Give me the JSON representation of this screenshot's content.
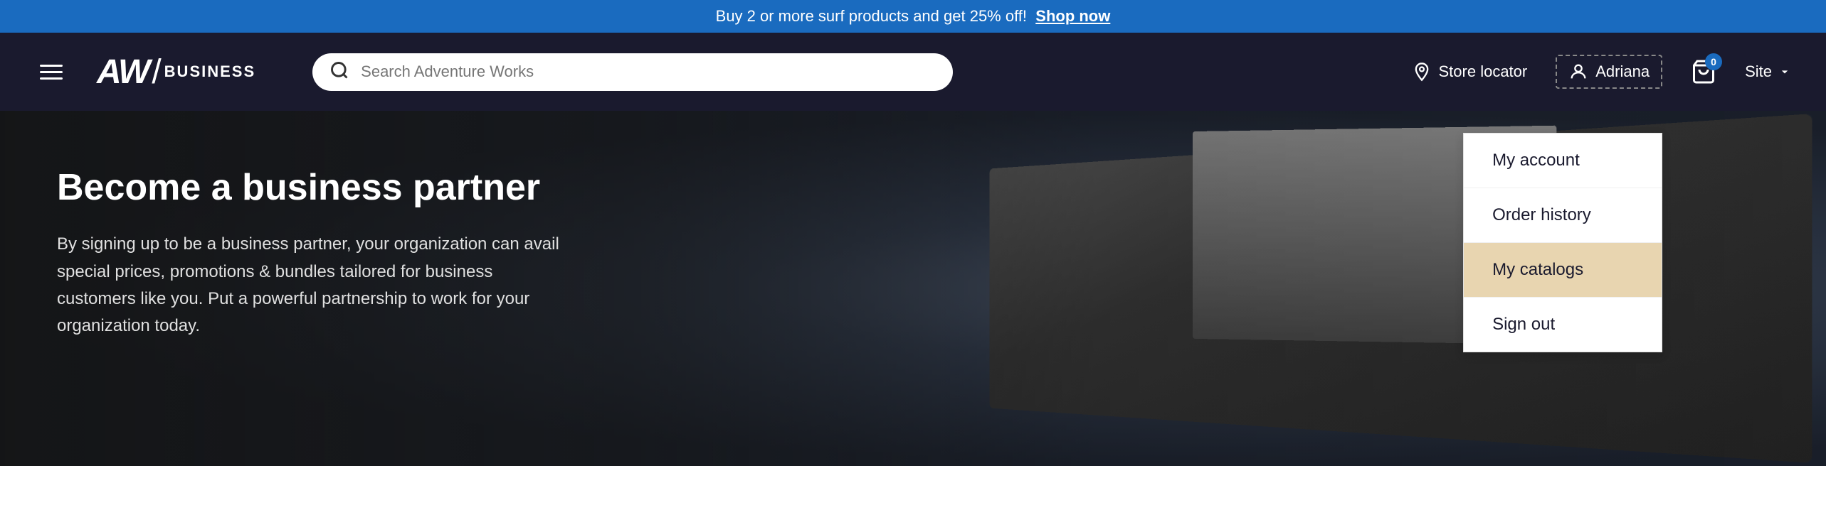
{
  "promo": {
    "text": "Buy 2 or more surf products and get 25% off!",
    "link_text": "Shop now"
  },
  "header": {
    "logo_aw": "AW",
    "logo_slash": "/",
    "logo_business": "BUSINESS",
    "search_placeholder": "Search Adventure Works",
    "store_locator_label": "Store locator",
    "user_name": "Adriana",
    "cart_count": "0",
    "site_label": "Site"
  },
  "dropdown": {
    "items": [
      {
        "label": "My account",
        "id": "my-account",
        "active": false
      },
      {
        "label": "Order history",
        "id": "order-history",
        "active": false
      },
      {
        "label": "My catalogs",
        "id": "my-catalogs",
        "active": true
      },
      {
        "label": "Sign out",
        "id": "sign-out",
        "active": false
      }
    ]
  },
  "hero": {
    "title": "Become a business partner",
    "description": "By signing up to be a business partner, your organization can avail special prices, promotions & bundles tailored for business customers like you. Put a powerful partnership to work for your organization today."
  }
}
